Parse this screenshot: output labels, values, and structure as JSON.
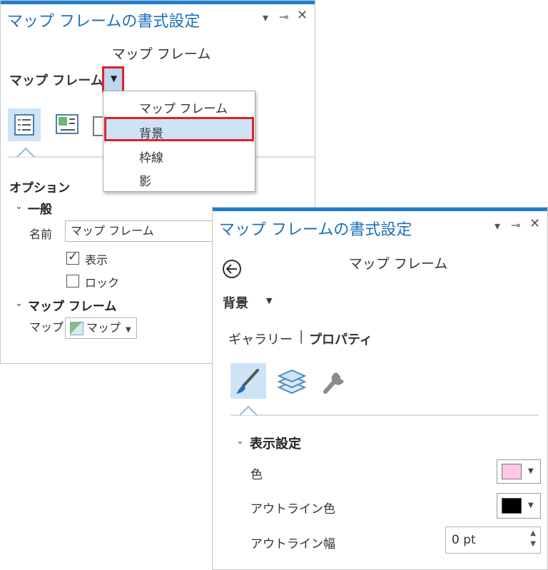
{
  "back_pane": {
    "title": "マップ フレームの書式設定",
    "subtitle": "マップ フレーム",
    "element_selector": "マップ フレーム",
    "dropdown_items": [
      "マップ フレーム",
      "背景",
      "枠線",
      "影"
    ],
    "options_header": "オプション",
    "general_header": "一般",
    "name_label": "名前",
    "name_value": "マップ フレーム",
    "visible_label": "表示",
    "visible_checked": true,
    "lock_label": "ロック",
    "lock_checked": false,
    "mapframe_header": "マップ フレーム",
    "map_label": "マップ",
    "map_value": "マップ"
  },
  "front_pane": {
    "title": "マップ フレームの書式設定",
    "subtitle": "マップ フレーム",
    "element_selector": "背景",
    "tab_gallery": "ギャラリー",
    "tab_separator": "|",
    "tab_properties": "プロパティ",
    "section_header": "表示設定",
    "color_label": "色",
    "color_value": "#ffc8e6",
    "outline_color_label": "アウトライン色",
    "outline_color_value": "#000000",
    "outline_width_label": "アウトライン幅",
    "outline_width_value": "0 pt"
  },
  "colors": {
    "accent": "#1e7fd0",
    "title_text": "#1f6fb8",
    "highlight_border": "#e0202a",
    "selected_bg": "#cfe3f6"
  }
}
